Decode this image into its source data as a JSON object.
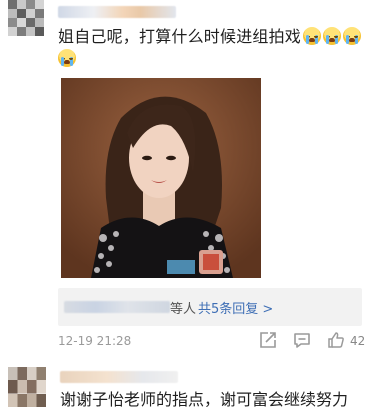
{
  "comment_1": {
    "text": "姐自己呢，打算什么时候进组拍戏",
    "emoji_name": "crying-face-icon",
    "replies": {
      "suffix": "等人",
      "link_label": "共5条回复 >"
    },
    "timestamp": "12-19 21:28",
    "actions": {
      "share_icon": "share-icon",
      "comment_icon": "comment-icon",
      "like_icon": "thumbs-up-icon",
      "like_count": "42"
    }
  },
  "comment_2": {
    "text": "谢谢子怡老师的指点，谢可富会继续努力"
  },
  "colors": {
    "link": "#3f6fb5",
    "meta": "#9a9a9a",
    "reply_bg": "#f2f2f2"
  }
}
